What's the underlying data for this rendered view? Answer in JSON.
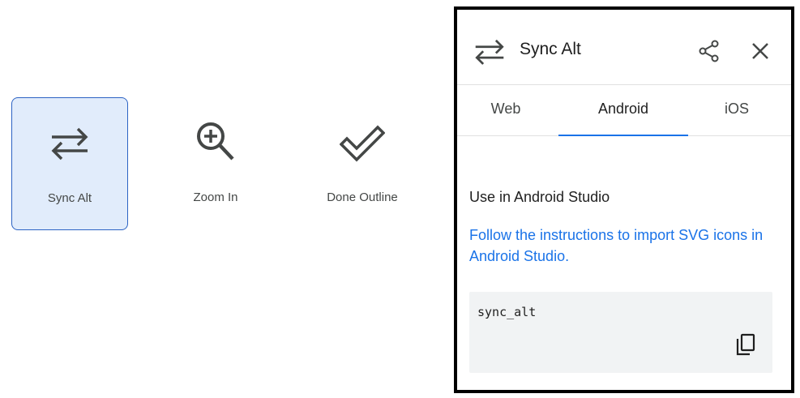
{
  "icons": [
    {
      "label": "Sync Alt",
      "icon": "sync-alt-icon",
      "selected": true
    },
    {
      "label": "Zoom In",
      "icon": "zoom-in-icon",
      "selected": false
    },
    {
      "label": "Done Outline",
      "icon": "done-outline-icon",
      "selected": false
    }
  ],
  "panel": {
    "title": "Sync Alt",
    "icon": "sync-alt-icon",
    "tabs": [
      {
        "label": "Web",
        "active": false
      },
      {
        "label": "Android",
        "active": true
      },
      {
        "label": "iOS",
        "active": false
      }
    ],
    "section_title": "Use in Android Studio",
    "instructions_link": "Follow the instructions to import SVG icons in Android Studio.",
    "code_name": "sync_alt"
  },
  "colors": {
    "accent": "#1a73e8",
    "selected_bg": "#e1ecfb",
    "selected_border": "#2c63c4",
    "code_bg": "#f1f3f4"
  }
}
